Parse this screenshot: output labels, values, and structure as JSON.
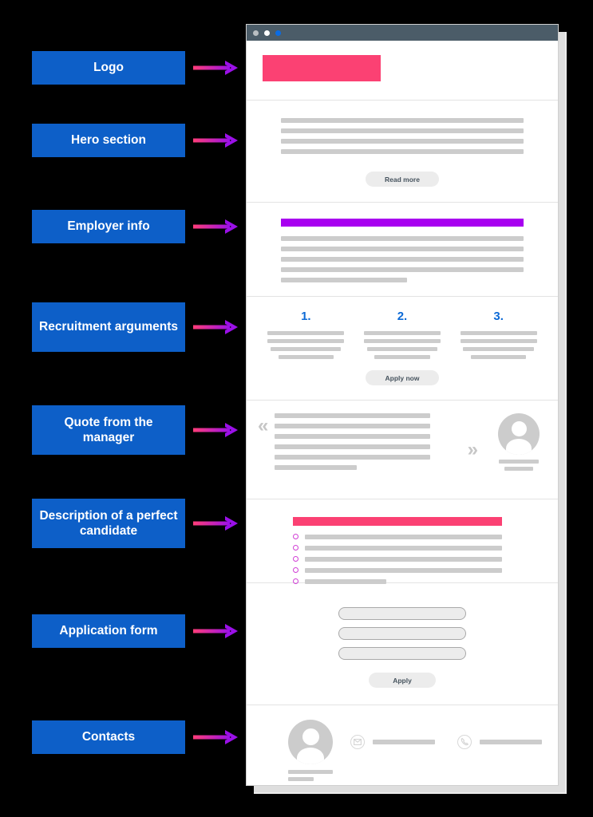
{
  "annotations": [
    {
      "label": "Logo",
      "icon": "arrow-right-icon"
    },
    {
      "label": "Hero section",
      "icon": "arrow-right-icon"
    },
    {
      "label": "Employer info",
      "icon": "arrow-right-icon"
    },
    {
      "label": "Recruitment arguments",
      "icon": "arrow-right-icon"
    },
    {
      "label": "Quote from the manager",
      "icon": "arrow-right-icon"
    },
    {
      "label": "Description of a perfect candidate",
      "icon": "arrow-right-icon"
    },
    {
      "label": "Application form",
      "icon": "arrow-right-icon"
    },
    {
      "label": "Contacts",
      "icon": "arrow-right-icon"
    }
  ],
  "browser": {
    "dots": [
      "gray",
      "white",
      "blue"
    ]
  },
  "page": {
    "hero": {
      "read_more_label": "Read more"
    },
    "arguments": {
      "items": [
        {
          "number": "1."
        },
        {
          "number": "2."
        },
        {
          "number": "3."
        }
      ],
      "apply_now_label": "Apply now"
    },
    "quote": {
      "open_mark": "«",
      "close_mark": "»"
    },
    "form": {
      "apply_label": "Apply"
    },
    "contacts": {
      "email_icon": "envelope-icon",
      "phone_icon": "phone-icon"
    }
  },
  "colors": {
    "label_blue": "#0d5fc8",
    "logo_pink": "#fb4173",
    "employer_purple": "#a800f0",
    "candidate_pink": "#fb4173",
    "number_blue": "#0d6ad6",
    "bullet_ring": "#d13fd6",
    "titlebar": "#4b5c68",
    "placeholder_gray": "#cccccc",
    "arrow_gradient_start": "#ff3d78",
    "arrow_gradient_end": "#9b10e8"
  }
}
